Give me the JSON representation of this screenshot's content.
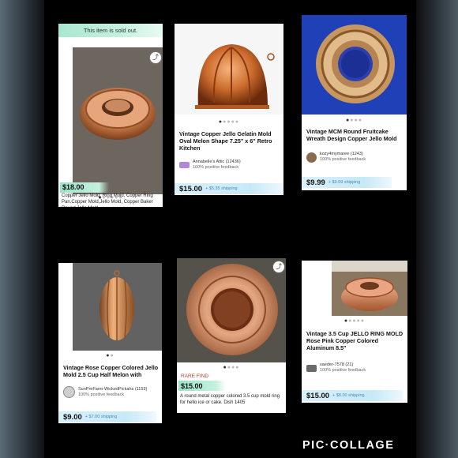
{
  "collage": {
    "watermark": "PIC·COLLAGE"
  },
  "cards": [
    {
      "sold_banner": "This item is sold out.",
      "price": "$18.00",
      "description": "Copper Jello Mold, Ring Mold, Copper Ring Pan,Copper Mold,Jello Mold, Copper Baker Round Jello Mold",
      "share_icon": "share-icon"
    },
    {
      "title": "Vintage Copper Jello Gelatin Mold Oval Melon Shape 7.25\" x 6\" Retro Kitchen",
      "seller": "Annabelle's Attic (12436)",
      "feedback": "100% positive feedback",
      "price": "$15.00",
      "shipping": "+ $5.35 shipping"
    },
    {
      "title": "Vintage MCM Round Fruitcake Wreath Design Copper Jello Mold",
      "seller": "kozy4mymaree (1243)",
      "feedback": "100% positive feedback",
      "price": "$9.99",
      "shipping": "+ $9.99 shipping"
    },
    {
      "title": "Vintage Rose Copper Colored Jello Mold 2.5 Cup Half Melon with Hanger",
      "seller": "SunPreFarm-WickedPickahs (1153)",
      "feedback": "100% positive feedback",
      "price": "$9.00",
      "shipping": "+ $7.00 shipping"
    },
    {
      "tag": "RARE FIND",
      "price": "$15.00",
      "description": "A round metal copper colored 3.5 cup mold ring for hello ice or cake. Dish 1405",
      "share_icon": "share-icon"
    },
    {
      "title": "Vintage 3.5  Cup JELLO RING MOLD Rose Pink Copper Colored Aluminum 8.5\"",
      "seller": "saeder-7578 (21)",
      "feedback": "100% positive feedback",
      "price": "$15.00",
      "shipping": "+ $8.00 shipping"
    }
  ]
}
